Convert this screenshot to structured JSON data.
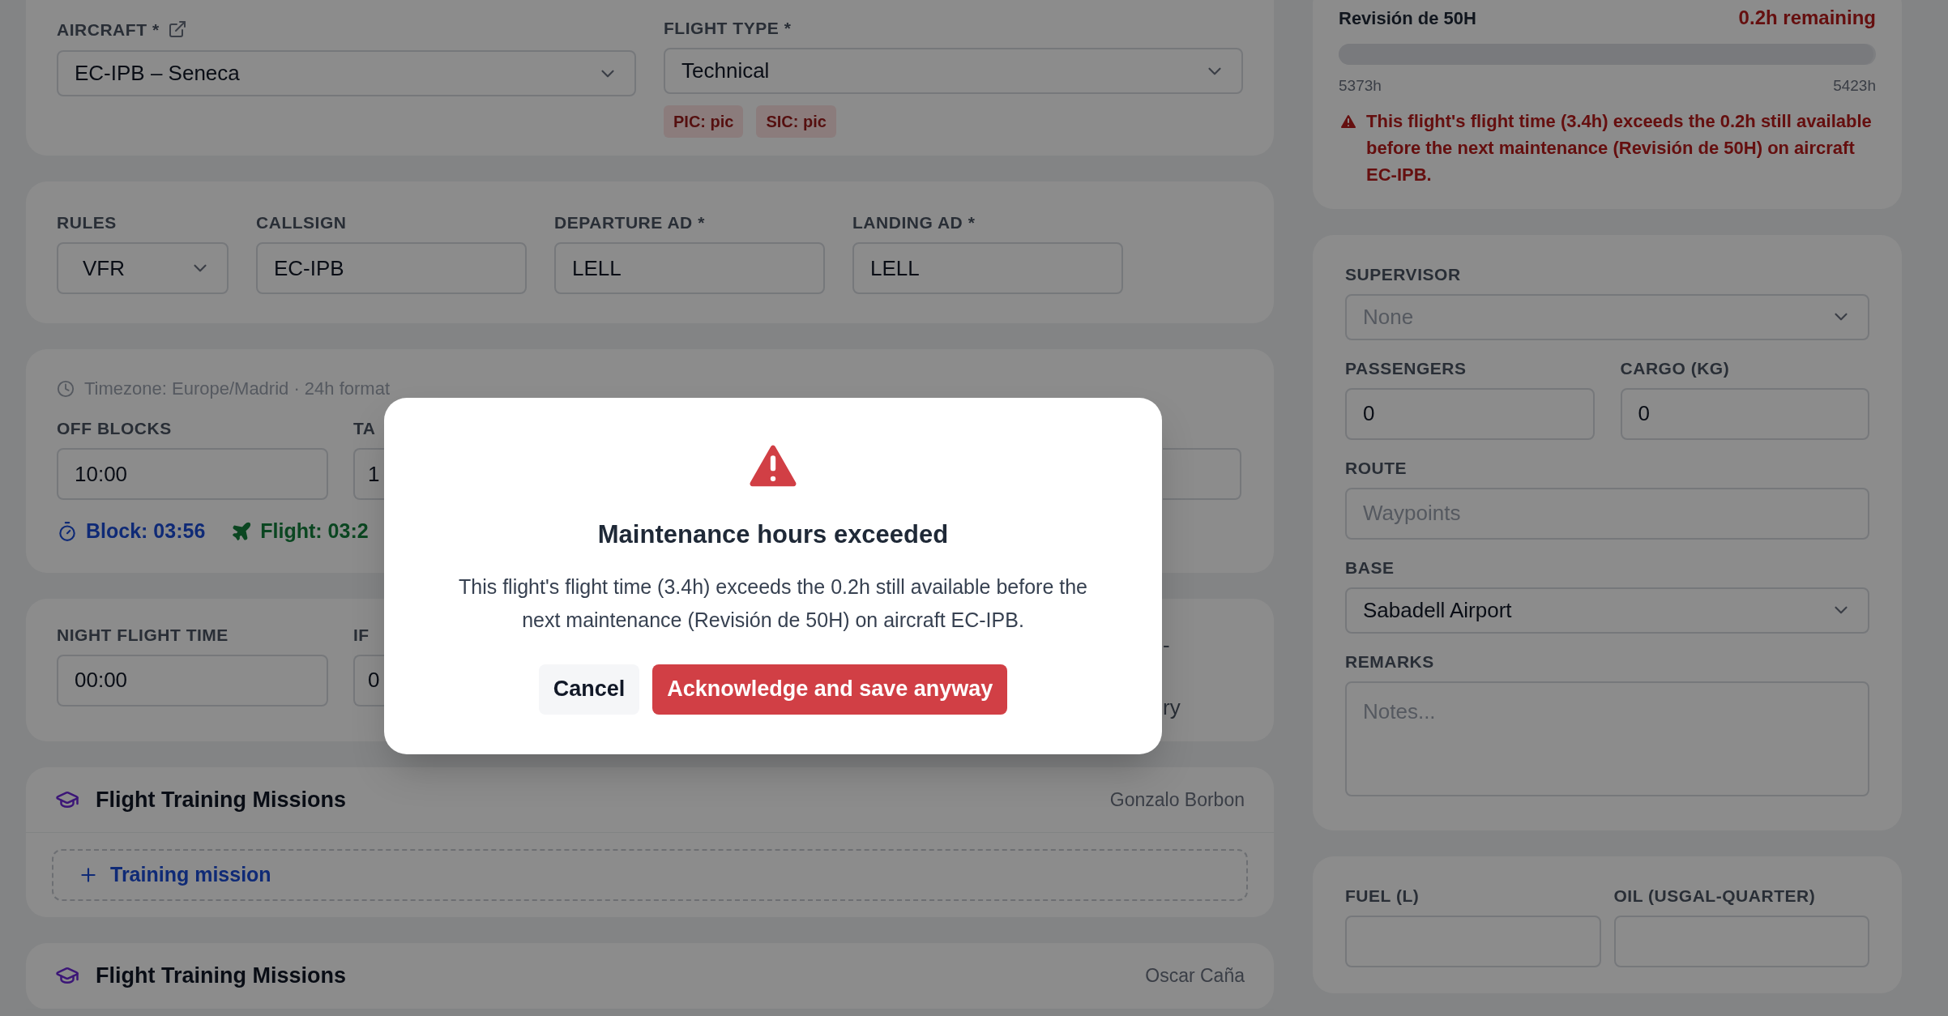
{
  "flight_card": {
    "aircraft": {
      "label": "AIRCRAFT *",
      "value": "EC-IPB – Seneca"
    },
    "flight_type": {
      "label": "FLIGHT TYPE *",
      "value": "Technical"
    },
    "badges": [
      "PIC: pic",
      "SIC: pic"
    ]
  },
  "route_card": {
    "fields": [
      {
        "kind": "select",
        "label": "RULES",
        "value": "VFR"
      },
      {
        "kind": "input",
        "label": "CALLSIGN",
        "value": "EC-IPB"
      },
      {
        "kind": "input",
        "label": "DEPARTURE AD *",
        "value": "LELL"
      },
      {
        "kind": "input",
        "label": "LANDING AD *",
        "value": "LELL"
      }
    ]
  },
  "times_card": {
    "timezone": "Timezone: Europe/Madrid · 24h format",
    "off_blocks": {
      "label": "OFF BLOCKS",
      "value": "10:00"
    },
    "cut_field": {
      "label": "TA",
      "value": "1"
    },
    "block": "Block: 03:56",
    "flight": "Flight: 03:2"
  },
  "night_card": {
    "night": {
      "label": "NIGHT FLIGHT TIME",
      "value": "00:00"
    },
    "cut_field": {
      "label": "IF",
      "value": "0"
    },
    "right_fragments": [
      "-",
      "ry"
    ]
  },
  "training_sections": [
    {
      "title": "Flight Training Missions",
      "instructor": "Gonzalo Borbon",
      "add_button": "Training mission"
    },
    {
      "title": "Flight Training Missions",
      "instructor": "Oscar Caña"
    }
  ],
  "maintenance": {
    "name": "Revisión de 50H",
    "remaining": "0.2h remaining",
    "level": 0.996,
    "start": "5373h",
    "end": "5423h",
    "warning": "This flight's flight time (3.4h) exceeds the 0.2h still available before the next maintenance (Revisión de 50H) on aircraft EC-IPB."
  },
  "details_card": {
    "supervisor": {
      "label": "SUPERVISOR",
      "placeholder": "None"
    },
    "passengers": {
      "label": "PASSENGERS",
      "value": "0"
    },
    "cargo": {
      "label": "CARGO (KG)",
      "value": "0"
    },
    "route": {
      "label": "ROUTE",
      "placeholder": "Waypoints"
    },
    "base": {
      "label": "BASE",
      "value": "Sabadell Airport"
    },
    "remarks": {
      "label": "REMARKS",
      "placeholder": "Notes..."
    }
  },
  "fuel_card": {
    "fuel": {
      "label": "FUEL (L)"
    },
    "oil": {
      "label": "OIL (USGAL-QUARTER)"
    }
  },
  "dialog": {
    "title": "Maintenance hours exceeded",
    "message": "This flight's flight time (3.4h) exceeds the 0.2h still available before the next maintenance (Revisión de 50H) on aircraft EC-IPB.",
    "buttons": [
      {
        "kind": "secondary",
        "label": "Cancel"
      },
      {
        "kind": "danger",
        "label": "Acknowledge and save anyway"
      }
    ]
  }
}
